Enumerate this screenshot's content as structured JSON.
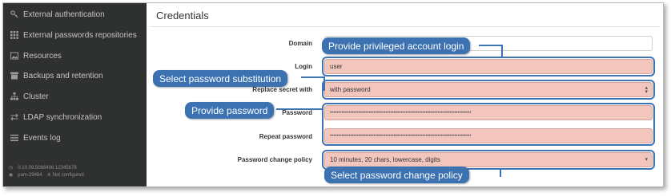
{
  "sidebar": {
    "items": [
      {
        "label": "External authentication",
        "icon": "key-icon"
      },
      {
        "label": "External passwords repositories",
        "icon": "grid-icon"
      },
      {
        "label": "Resources",
        "icon": "image-icon"
      },
      {
        "label": "Backups and retention",
        "icon": "archive-icon"
      },
      {
        "label": "Cluster",
        "icon": "sitemap-icon"
      },
      {
        "label": "LDAP synchronization",
        "icon": "exchange-icon"
      },
      {
        "label": "Events log",
        "icon": "list-icon"
      }
    ],
    "footer": {
      "version": "0.10.09.5066406 12345678",
      "host": "pam-29484",
      "status": "Not configured"
    }
  },
  "main": {
    "title": "Credentials",
    "fields": {
      "domain": {
        "label": "Domain",
        "value": ""
      },
      "login": {
        "label": "Login",
        "value": "user"
      },
      "replace": {
        "label": "Replace secret with",
        "value": "with password"
      },
      "password": {
        "label": "Password",
        "value": "••••••••••••••••••••••••••••••••••••••••••••••••••••••••••••••••••••••••••••••••••••"
      },
      "repeat": {
        "label": "Repeat password",
        "value": "••••••••••••••••••••••••••••••••••••••••••••••••••••••••••••••••••••••••••••••••••••"
      },
      "policy": {
        "label": "Password change policy",
        "value": "10 minutes, 20 chars, lowercase, digits"
      }
    }
  },
  "callouts": {
    "login": "Provide privileged account login",
    "substitution": "Select password substitution",
    "password": "Provide password",
    "policy": "Select password change policy"
  },
  "colors": {
    "sidebar_bg": "#2f3130",
    "highlight_fill": "#f2c6bd",
    "callout_blue": "#3c72b2"
  }
}
